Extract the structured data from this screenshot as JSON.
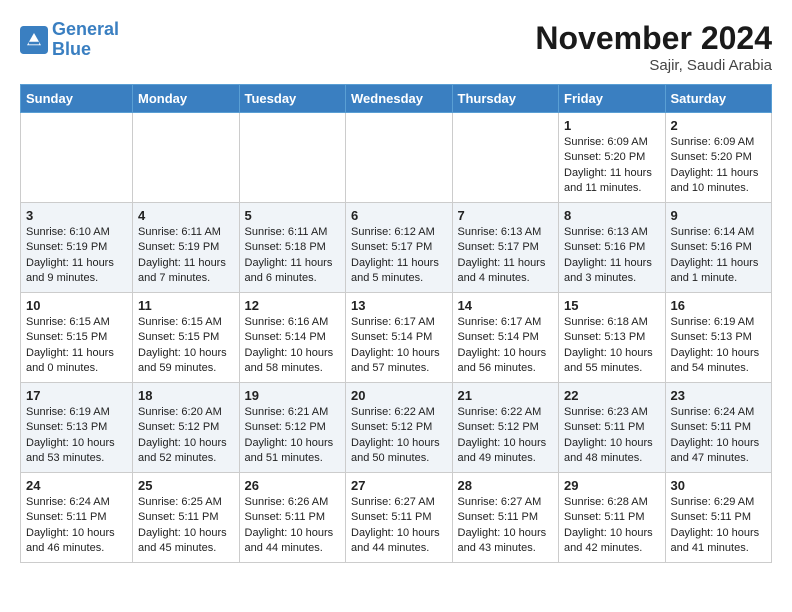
{
  "logo": {
    "line1": "General",
    "line2": "Blue"
  },
  "title": "November 2024",
  "location": "Sajir, Saudi Arabia",
  "days_of_week": [
    "Sunday",
    "Monday",
    "Tuesday",
    "Wednesday",
    "Thursday",
    "Friday",
    "Saturday"
  ],
  "weeks": [
    [
      {
        "day": "",
        "content": ""
      },
      {
        "day": "",
        "content": ""
      },
      {
        "day": "",
        "content": ""
      },
      {
        "day": "",
        "content": ""
      },
      {
        "day": "",
        "content": ""
      },
      {
        "day": "1",
        "content": "Sunrise: 6:09 AM\nSunset: 5:20 PM\nDaylight: 11 hours and 11 minutes."
      },
      {
        "day": "2",
        "content": "Sunrise: 6:09 AM\nSunset: 5:20 PM\nDaylight: 11 hours and 10 minutes."
      }
    ],
    [
      {
        "day": "3",
        "content": "Sunrise: 6:10 AM\nSunset: 5:19 PM\nDaylight: 11 hours and 9 minutes."
      },
      {
        "day": "4",
        "content": "Sunrise: 6:11 AM\nSunset: 5:19 PM\nDaylight: 11 hours and 7 minutes."
      },
      {
        "day": "5",
        "content": "Sunrise: 6:11 AM\nSunset: 5:18 PM\nDaylight: 11 hours and 6 minutes."
      },
      {
        "day": "6",
        "content": "Sunrise: 6:12 AM\nSunset: 5:17 PM\nDaylight: 11 hours and 5 minutes."
      },
      {
        "day": "7",
        "content": "Sunrise: 6:13 AM\nSunset: 5:17 PM\nDaylight: 11 hours and 4 minutes."
      },
      {
        "day": "8",
        "content": "Sunrise: 6:13 AM\nSunset: 5:16 PM\nDaylight: 11 hours and 3 minutes."
      },
      {
        "day": "9",
        "content": "Sunrise: 6:14 AM\nSunset: 5:16 PM\nDaylight: 11 hours and 1 minute."
      }
    ],
    [
      {
        "day": "10",
        "content": "Sunrise: 6:15 AM\nSunset: 5:15 PM\nDaylight: 11 hours and 0 minutes."
      },
      {
        "day": "11",
        "content": "Sunrise: 6:15 AM\nSunset: 5:15 PM\nDaylight: 10 hours and 59 minutes."
      },
      {
        "day": "12",
        "content": "Sunrise: 6:16 AM\nSunset: 5:14 PM\nDaylight: 10 hours and 58 minutes."
      },
      {
        "day": "13",
        "content": "Sunrise: 6:17 AM\nSunset: 5:14 PM\nDaylight: 10 hours and 57 minutes."
      },
      {
        "day": "14",
        "content": "Sunrise: 6:17 AM\nSunset: 5:14 PM\nDaylight: 10 hours and 56 minutes."
      },
      {
        "day": "15",
        "content": "Sunrise: 6:18 AM\nSunset: 5:13 PM\nDaylight: 10 hours and 55 minutes."
      },
      {
        "day": "16",
        "content": "Sunrise: 6:19 AM\nSunset: 5:13 PM\nDaylight: 10 hours and 54 minutes."
      }
    ],
    [
      {
        "day": "17",
        "content": "Sunrise: 6:19 AM\nSunset: 5:13 PM\nDaylight: 10 hours and 53 minutes."
      },
      {
        "day": "18",
        "content": "Sunrise: 6:20 AM\nSunset: 5:12 PM\nDaylight: 10 hours and 52 minutes."
      },
      {
        "day": "19",
        "content": "Sunrise: 6:21 AM\nSunset: 5:12 PM\nDaylight: 10 hours and 51 minutes."
      },
      {
        "day": "20",
        "content": "Sunrise: 6:22 AM\nSunset: 5:12 PM\nDaylight: 10 hours and 50 minutes."
      },
      {
        "day": "21",
        "content": "Sunrise: 6:22 AM\nSunset: 5:12 PM\nDaylight: 10 hours and 49 minutes."
      },
      {
        "day": "22",
        "content": "Sunrise: 6:23 AM\nSunset: 5:11 PM\nDaylight: 10 hours and 48 minutes."
      },
      {
        "day": "23",
        "content": "Sunrise: 6:24 AM\nSunset: 5:11 PM\nDaylight: 10 hours and 47 minutes."
      }
    ],
    [
      {
        "day": "24",
        "content": "Sunrise: 6:24 AM\nSunset: 5:11 PM\nDaylight: 10 hours and 46 minutes."
      },
      {
        "day": "25",
        "content": "Sunrise: 6:25 AM\nSunset: 5:11 PM\nDaylight: 10 hours and 45 minutes."
      },
      {
        "day": "26",
        "content": "Sunrise: 6:26 AM\nSunset: 5:11 PM\nDaylight: 10 hours and 44 minutes."
      },
      {
        "day": "27",
        "content": "Sunrise: 6:27 AM\nSunset: 5:11 PM\nDaylight: 10 hours and 44 minutes."
      },
      {
        "day": "28",
        "content": "Sunrise: 6:27 AM\nSunset: 5:11 PM\nDaylight: 10 hours and 43 minutes."
      },
      {
        "day": "29",
        "content": "Sunrise: 6:28 AM\nSunset: 5:11 PM\nDaylight: 10 hours and 42 minutes."
      },
      {
        "day": "30",
        "content": "Sunrise: 6:29 AM\nSunset: 5:11 PM\nDaylight: 10 hours and 41 minutes."
      }
    ]
  ]
}
